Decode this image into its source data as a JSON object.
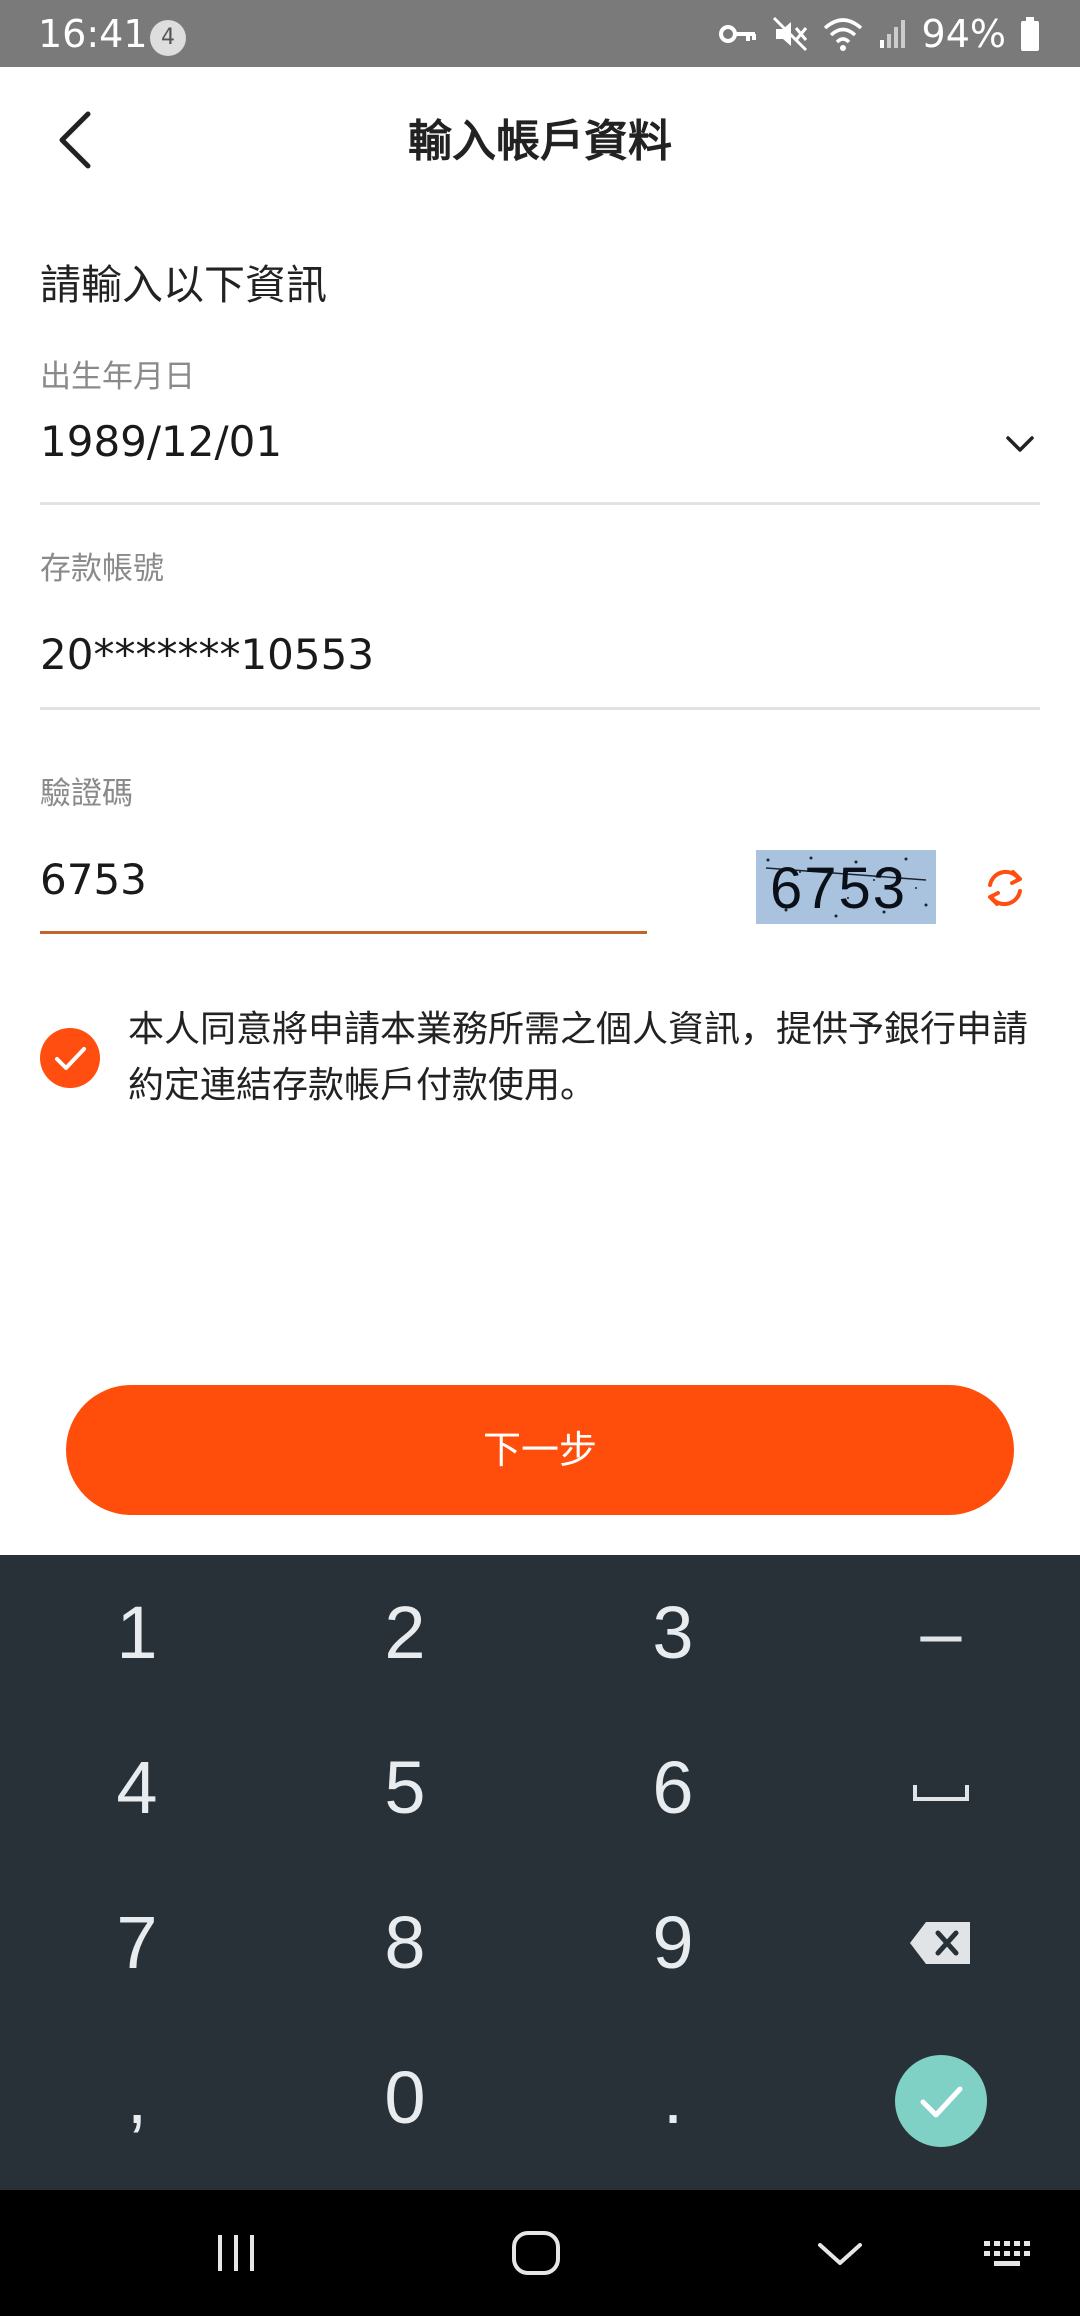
{
  "status_bar": {
    "time": "16:41",
    "notification_count": "4",
    "battery_percent": "94%"
  },
  "header": {
    "title": "輸入帳戶資料"
  },
  "form": {
    "section_title": "請輸入以下資訊",
    "birthdate_label": "出生年月日",
    "birthdate_value": "1989/12/01",
    "account_label": "存款帳號",
    "account_value": "20*******10553",
    "captcha_label": "驗證碼",
    "captcha_value": "6753",
    "captcha_image_text": "6753"
  },
  "consent": {
    "checked": true,
    "text": "本人同意將申請本業務所需之個人資訊，提供予銀行申請約定連結存款帳戶付款使用。"
  },
  "next_button": {
    "label": "下一步"
  },
  "keyboard": {
    "rows": [
      [
        "1",
        "2",
        "3",
        "–"
      ],
      [
        "4",
        "5",
        "6",
        "space"
      ],
      [
        "7",
        "8",
        "9",
        "backspace"
      ],
      [
        ",",
        "0",
        ".",
        "enter"
      ]
    ]
  },
  "colors": {
    "accent": "#ff4e10",
    "keyboard_bg": "#283137",
    "enter_key": "#7fd0c5"
  }
}
